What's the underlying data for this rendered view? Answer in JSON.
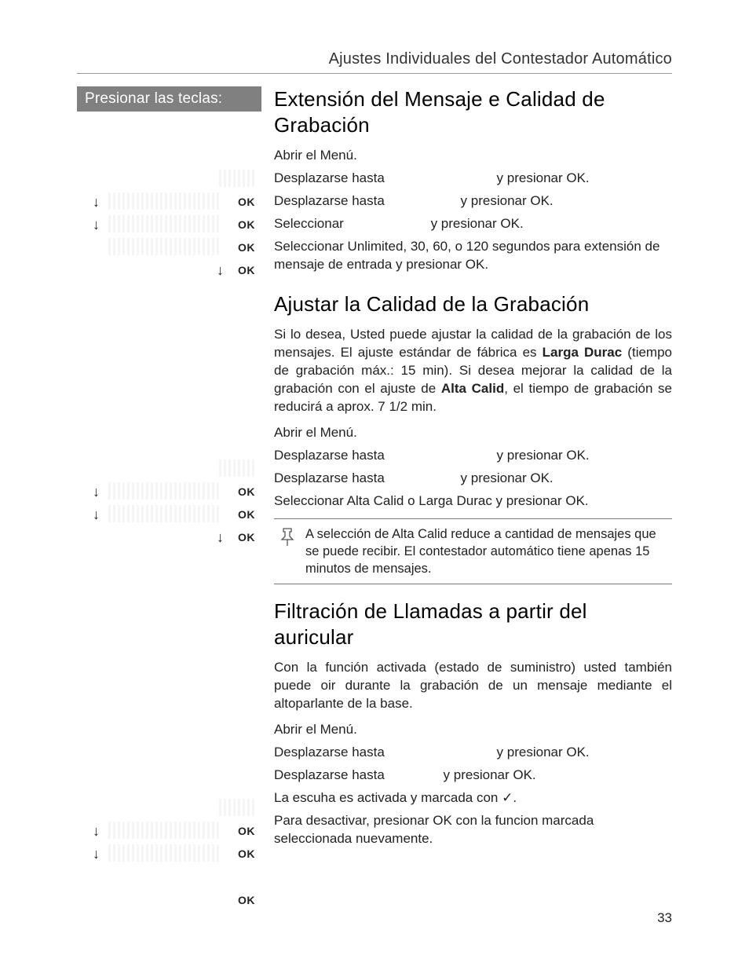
{
  "running_head": "Ajustes Individuales del Contestador Automático",
  "left_header": "Presionar las teclas:",
  "ok_label": "OK",
  "arrow_glyph": "↓",
  "check_glyph": "✓",
  "pin_glyph": "📌",
  "page_number": "33",
  "sec1": {
    "title": "Extensión del Mensaje e Calidad de Grabación",
    "s1": "Abrir el Menú.",
    "s2a": "Desplazarse hasta",
    "s2b": "y presionar OK.",
    "s3a": "Desplazarse hasta",
    "s3b": "y presionar OK.",
    "s4a": "Seleccionar",
    "s4b": "y presionar OK.",
    "s5": "Seleccionar Unlimited, 30, 60, o 120 segundos para extensión de mensaje de entrada y presionar OK."
  },
  "sec2": {
    "title": "Ajustar la Calidad de la Grabación",
    "p1a": "Si lo desea, Usted puede ajustar la calidad de la grabación de los mensajes. El ajuste estándar de fábrica es ",
    "p1b": "Larga Durac",
    "p1c": " (tiempo de grabación máx.: 15 min).  Si desea mejorar la calidad de la grabación con el ajuste de ",
    "p1d": "Alta Calid",
    "p1e": ", el tiempo de grabación se reducirá a aprox. 7 1/2 min.",
    "s1": "Abrir el Menú.",
    "s2a": "Desplazarse hasta",
    "s2b": "y presionar OK.",
    "s3a": "Desplazarse hasta",
    "s3b": "y presionar OK.",
    "s4": "Seleccionar Alta Calid o Larga Durac y presionar OK.",
    "note": "A selección de Alta Calid reduce a cantidad de mensajes que se puede recibir. El contestador automático tiene apenas 15 minutos de mensajes."
  },
  "sec3": {
    "title": "Filtración de Llamadas a partir del auricular",
    "p1": "Con la función activada (estado de suministro) usted también puede oir durante la grabación de un mensaje mediante el altoparlante de la base.",
    "s1": "Abrir el Menú.",
    "s2a": "Desplazarse hasta",
    "s2b": "y presionar OK.",
    "s3a": "Desplazarse hasta",
    "s3b": "y presionar OK.",
    "s4a": "La escuha es activada y marcada con ",
    "s4b": ".",
    "s5": "Para desactivar, presionar OK con la funcion marcada seleccionada nuevamente."
  }
}
